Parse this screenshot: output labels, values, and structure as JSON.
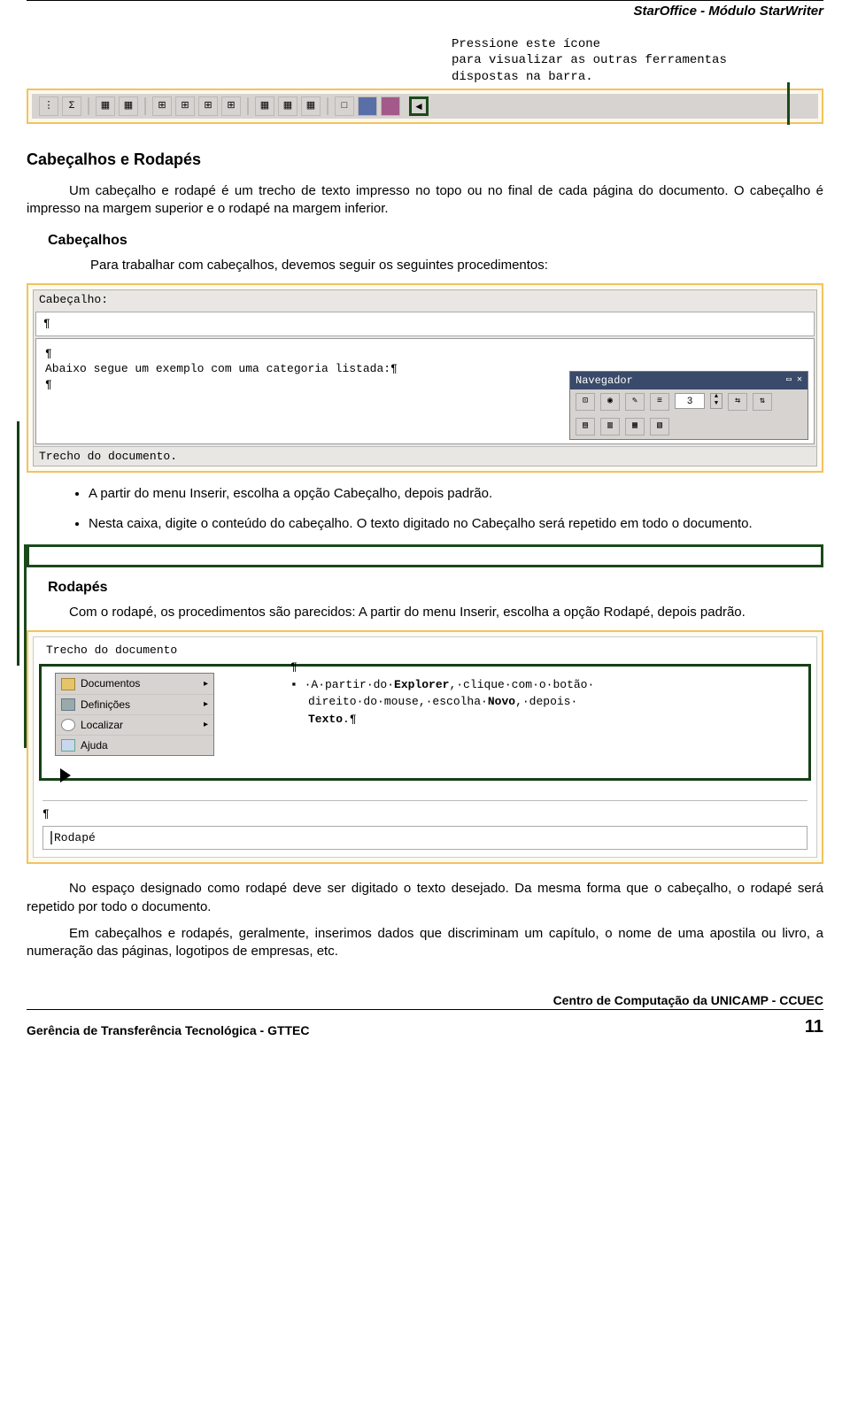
{
  "doc_header": "StarOffice - Módulo StarWriter",
  "callout": {
    "line1": "Pressione este ícone",
    "line2": "para visualizar as outras ferramentas",
    "line3": "dispostas na barra."
  },
  "toolbar_icons": {
    "sigma": "Σ",
    "arrow": "◄"
  },
  "section_title": "Cabeçalhos e Rodapés",
  "intro_p1": "Um cabeçalho e rodapé é um trecho de texto impresso no topo ou no final de cada página do documento. O cabeçalho é impresso na margem superior e o rodapé na margem inferior.",
  "sub_cabecalhos": "Cabeçalhos",
  "cabecalhos_p": "Para trabalhar com cabeçalhos, devemos seguir os seguintes procedimentos:",
  "screenshot1": {
    "label": "Cabeçalho:",
    "line": "Abaixo segue um exemplo com uma categoria listada:¶",
    "trecho": "Trecho do documento.",
    "nav_title": "Navegador",
    "nav_num": "3"
  },
  "bullets": {
    "b1": "A partir do menu Inserir, escolha a opção Cabeçalho, depois padrão.",
    "b2": "Nesta caixa, digite o conteúdo do cabeçalho. O texto digitado no Cabeçalho será repetido em todo o documento."
  },
  "sub_rodapes": "Rodapés",
  "rodapes_p": "Com o rodapé, os procedimentos são parecidos: A partir do menu Inserir, escolha a opção Rodapé, depois padrão.",
  "screenshot2": {
    "trecho": "Trecho do documento",
    "menu": {
      "item1": "Documentos",
      "item2": "Definições",
      "item3": "Localizar",
      "item4": "Ajuda"
    },
    "doc_line_pre": "▪  ·A·partir·do·",
    "doc_bold": "Explorer",
    "doc_line_mid": ",·clique·com·o·botão·",
    "doc_line2a": "direito·do·mouse,·escolha·",
    "doc_line2b": "Novo",
    "doc_line2c": ",·depois·",
    "doc_line3": "Texto",
    "rodape_label": "Rodapé"
  },
  "closing_p1": "No espaço designado como rodapé deve ser digitado o texto desejado. Da mesma forma que o cabeçalho, o rodapé será repetido por todo o documento.",
  "closing_p2": "Em cabeçalhos e rodapés, geralmente, inserimos dados que discriminam um capítulo, o nome de uma apostila ou livro, a numeração das páginas, logotipos de empresas, etc.",
  "footer": {
    "right": "Centro de Computação da UNICAMP - CCUEC",
    "left": "Gerência de Transferência Tecnológica - GTTEC",
    "page": "11"
  }
}
